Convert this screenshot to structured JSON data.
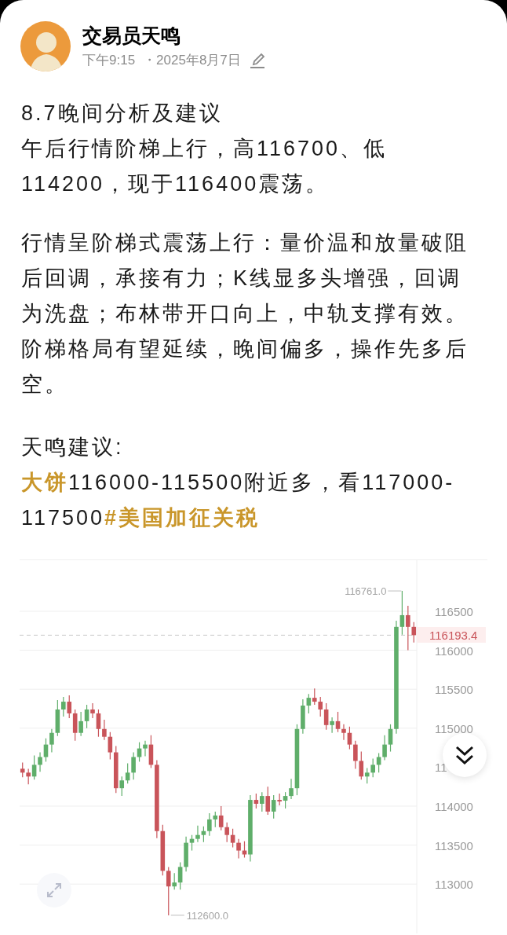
{
  "author": {
    "name": "交易员天鸣",
    "time": "下午9:15",
    "date": "・2025年8月7日"
  },
  "post": {
    "title": "8.7晚间分析及建议",
    "paragraphs": [
      {
        "segments": [
          {
            "kind": "plain",
            "text": "午后行情阶梯上行，高116700、低114200，现于116400震荡。"
          }
        ]
      },
      {
        "segments": [
          {
            "kind": "plain",
            "text": "行情呈阶梯式震荡上行：量价温和放量破阻后回调，承接有力；K线显多头增强，回调为洗盘；布林带开口向上，中轨支撑有效。阶梯格局有望延续，晚间偏多，操作先多后空。"
          }
        ]
      },
      {
        "segments": [
          {
            "kind": "plain",
            "text": "天鸣建议:"
          }
        ]
      },
      {
        "segments": [
          {
            "kind": "topic",
            "text": "大饼"
          },
          {
            "kind": "plain",
            "text": "116000-115500附近多，看117000-117500"
          },
          {
            "kind": "topic",
            "text": "#美国加征关税"
          }
        ]
      }
    ]
  },
  "chart": {
    "chart_data": {
      "type": "candlestick",
      "ohlc": [
        [
          114480,
          114560,
          114370,
          114430
        ],
        [
          114430,
          114480,
          114280,
          114380
        ],
        [
          114380,
          114650,
          114340,
          114530
        ],
        [
          114530,
          114690,
          114440,
          114630
        ],
        [
          114630,
          114870,
          114570,
          114790
        ],
        [
          114790,
          114990,
          114690,
          114940
        ],
        [
          114940,
          115360,
          114900,
          115240
        ],
        [
          115240,
          115400,
          115150,
          115340
        ],
        [
          115340,
          115420,
          115130,
          115190
        ],
        [
          115190,
          115240,
          114840,
          114940
        ],
        [
          114940,
          115210,
          114900,
          115090
        ],
        [
          115090,
          115300,
          115000,
          115240
        ],
        [
          115240,
          115320,
          115130,
          115190
        ],
        [
          115190,
          115240,
          114890,
          114990
        ],
        [
          114990,
          115110,
          114850,
          114890
        ],
        [
          114890,
          114950,
          114600,
          114690
        ],
        [
          114690,
          114770,
          114170,
          114230
        ],
        [
          114230,
          114380,
          114130,
          114330
        ],
        [
          114330,
          114550,
          114290,
          114430
        ],
        [
          114430,
          114690,
          114340,
          114630
        ],
        [
          114630,
          114820,
          114570,
          114740
        ],
        [
          114740,
          114840,
          114640,
          114790
        ],
        [
          114790,
          114910,
          114490,
          114530
        ],
        [
          114530,
          114590,
          113590,
          113680
        ],
        [
          113680,
          113760,
          113110,
          113170
        ],
        [
          113170,
          113220,
          112600,
          112970
        ],
        [
          112970,
          113140,
          112930,
          113020
        ],
        [
          113020,
          113280,
          112930,
          113220
        ],
        [
          113220,
          113610,
          113160,
          113530
        ],
        [
          113530,
          113630,
          113430,
          113580
        ],
        [
          113580,
          113750,
          113540,
          113630
        ],
        [
          113630,
          113740,
          113540,
          113680
        ],
        [
          113680,
          113910,
          113620,
          113830
        ],
        [
          113830,
          113930,
          113730,
          113880
        ],
        [
          113880,
          114000,
          113690,
          113730
        ],
        [
          113730,
          113790,
          113540,
          113630
        ],
        [
          113630,
          113710,
          113470,
          113530
        ],
        [
          113530,
          113580,
          113330,
          113430
        ],
        [
          113430,
          113550,
          113340,
          113380
        ],
        [
          113380,
          114140,
          113290,
          114080
        ],
        [
          114080,
          114160,
          113970,
          114030
        ],
        [
          114030,
          114180,
          113930,
          114130
        ],
        [
          114130,
          114250,
          113890,
          113930
        ],
        [
          113930,
          114140,
          113840,
          114080
        ],
        [
          114080,
          114160,
          114010,
          114070
        ],
        [
          114070,
          114180,
          113970,
          114130
        ],
        [
          114130,
          114350,
          114090,
          114230
        ],
        [
          114230,
          115050,
          114140,
          114990
        ],
        [
          114990,
          115370,
          114930,
          115290
        ],
        [
          115290,
          115440,
          115190,
          115390
        ],
        [
          115390,
          115510,
          115300,
          115340
        ],
        [
          115340,
          115400,
          115150,
          115240
        ],
        [
          115240,
          115320,
          114980,
          115040
        ],
        [
          115040,
          115140,
          114940,
          115090
        ],
        [
          115090,
          115210,
          114950,
          114990
        ],
        [
          114990,
          115050,
          114850,
          114940
        ],
        [
          114940,
          115020,
          114730,
          114790
        ],
        [
          114790,
          114840,
          114480,
          114580
        ],
        [
          114580,
          114700,
          114340,
          114380
        ],
        [
          114380,
          114490,
          114290,
          114430
        ],
        [
          114430,
          114610,
          114370,
          114530
        ],
        [
          114530,
          114680,
          114430,
          114630
        ],
        [
          114630,
          114910,
          114590,
          114790
        ],
        [
          114790,
          115050,
          114700,
          114990
        ],
        [
          114990,
          116380,
          114930,
          116300
        ],
        [
          116300,
          116761,
          116200,
          116450
        ],
        [
          116450,
          116570,
          116000,
          116300
        ],
        [
          116300,
          116360,
          116100,
          116193.4
        ]
      ],
      "grid": true,
      "ylim": [
        112367,
        117155
      ],
      "ref_lines": [
        {
          "axis": "y",
          "value": 116193.4
        }
      ],
      "yticks": [
        116500,
        116000,
        115500,
        115000,
        114000,
        113500,
        113000
      ]
    },
    "covered_tick_label": "11",
    "price_tag": "116193.4",
    "high_label": "116761.0",
    "low_label": "112600.0"
  }
}
